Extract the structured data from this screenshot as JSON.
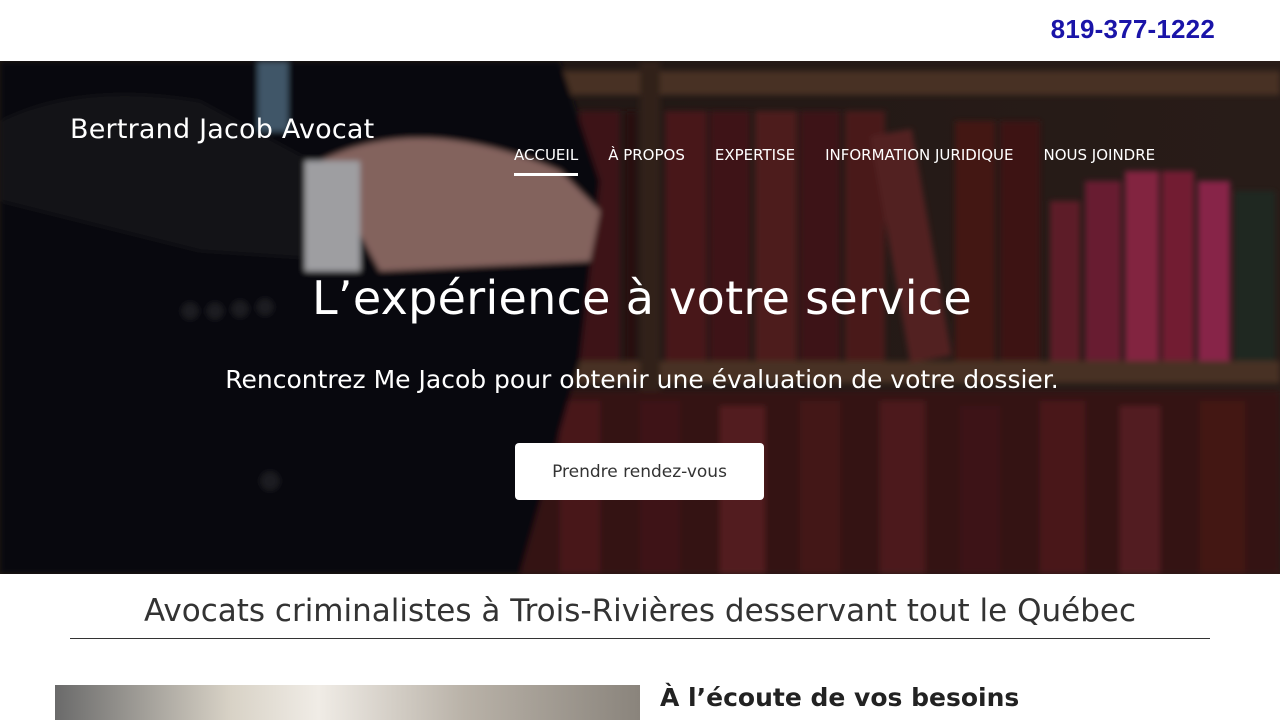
{
  "header": {
    "phone": "819-377-1222"
  },
  "hero": {
    "brand": "Bertrand Jacob Avocat",
    "nav": [
      {
        "label": "ACCUEIL",
        "active": true
      },
      {
        "label": "À PROPOS",
        "active": false
      },
      {
        "label": "EXPERTISE",
        "active": false
      },
      {
        "label": "INFORMATION JURIDIQUE",
        "active": false
      },
      {
        "label": "NOUS JOINDRE",
        "active": false
      }
    ],
    "title": "L’expérience à votre service",
    "subtitle": "Rencontrez Me Jacob pour obtenir une évaluation de votre dossier.",
    "cta_label": "Prendre rendez-vous"
  },
  "section": {
    "title": "Avocats criminalistes à Trois-Rivières desservant tout le Québec"
  },
  "feature": {
    "heading": "À l’écoute de vos besoins"
  }
}
